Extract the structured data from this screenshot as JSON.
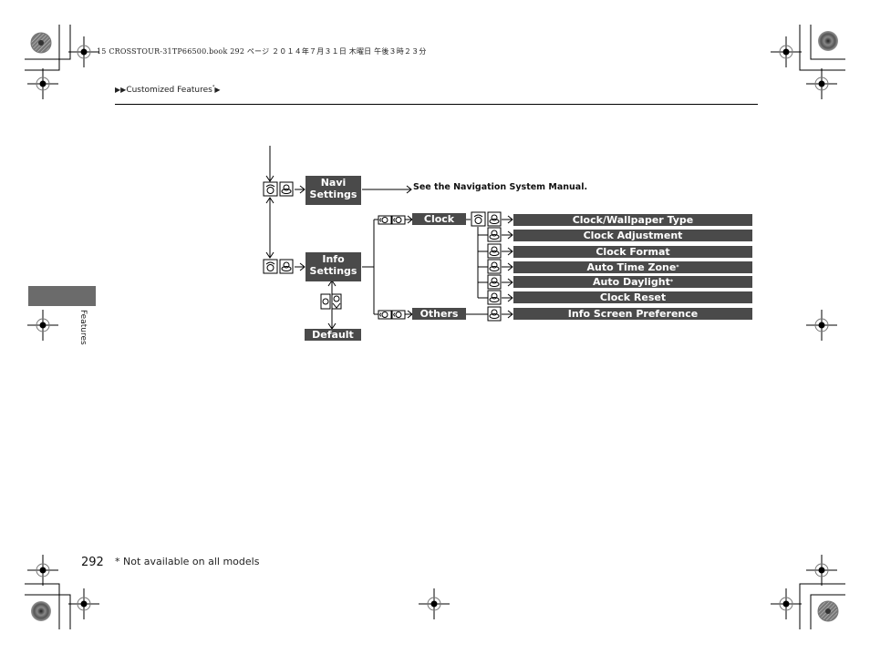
{
  "print_header": {
    "text": "15 CROSSTOUR-31TP66500.book  292 ページ  ２０１４年７月３１日  木曜日  午後３時２３分"
  },
  "breadcrumb": {
    "prefix_arrows": "▶▶",
    "label": "Customized Features",
    "asterisk": "*",
    "suffix_arrow": "▶"
  },
  "side_tab": {
    "label": "Features"
  },
  "diagram": {
    "navi_settings": {
      "line1": "Navi",
      "line2": "Settings",
      "note": "See the Navigation System Manual."
    },
    "info_settings": {
      "line1": "Info",
      "line2": "Settings"
    },
    "default_label": "Default",
    "categories": [
      {
        "label": "Clock"
      },
      {
        "label": "Others"
      }
    ],
    "clock_items": [
      {
        "label": "Clock/Wallpaper Type",
        "asterisk": ""
      },
      {
        "label": "Clock Adjustment",
        "asterisk": ""
      },
      {
        "label": "Clock Format",
        "asterisk": ""
      },
      {
        "label": "Auto Time Zone",
        "asterisk": "*"
      },
      {
        "label": "Auto Daylight",
        "asterisk": "*"
      },
      {
        "label": "Clock Reset",
        "asterisk": ""
      }
    ],
    "others_items": [
      {
        "label": "Info Screen Preference",
        "asterisk": ""
      }
    ],
    "icons": {
      "phone_button": "phone-button-icon",
      "selector_knob": "selector-knob-icon",
      "rotate_selector": "rotate-selector-icon",
      "press_selector": "press-selector-icon"
    }
  },
  "footer": {
    "page_number": "292",
    "footnote": "* Not available on all models"
  }
}
